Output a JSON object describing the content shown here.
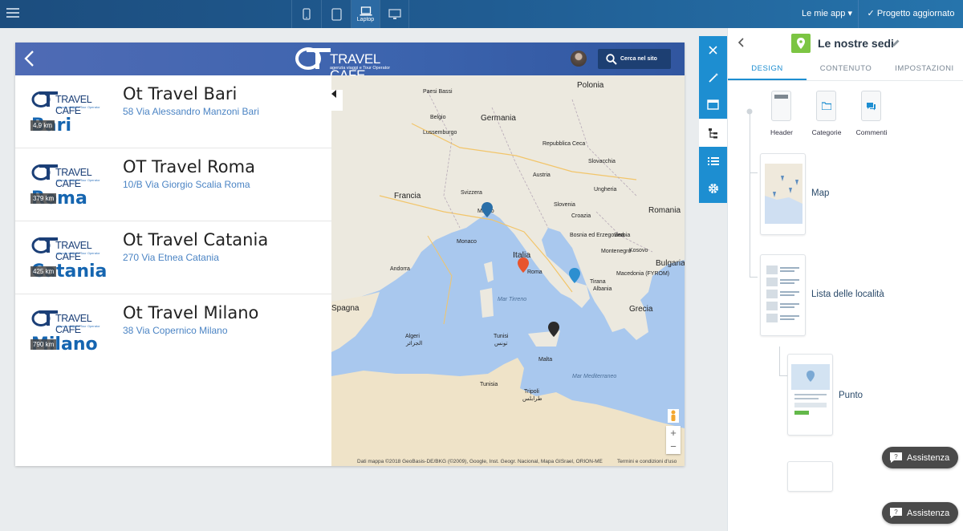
{
  "topbar": {
    "laptop_label": "Laptop",
    "my_apps_label": "Le mie app",
    "publish_label": "Progetto aggiornato"
  },
  "app": {
    "logo_text": "TRAVEL CAFE",
    "logo_subtitle": "agenzia viaggi e Tour Operator",
    "search_label": "Cerca nel sito",
    "locations": [
      {
        "name": "Ot Travel Bari",
        "address": "58 Via Alessandro Manzoni Bari",
        "city": "Bari",
        "distance": "4.9 km"
      },
      {
        "name": "OT Travel Roma",
        "address": "10/B Via Giorgio Scalia Roma",
        "city": "Roma",
        "distance": "379 km"
      },
      {
        "name": "Ot Travel Catania",
        "address": "270 Via Etnea Catania",
        "city": "Catania",
        "distance": "425 km"
      },
      {
        "name": "Ot Travel Milano",
        "address": "38 Via Copernico Milano",
        "city": "Milano",
        "distance": "790 km"
      }
    ],
    "card_logo_text": "TRAVEL CAFE",
    "card_logo_subtitle": "agenzia viaggi e Tour Operator"
  },
  "map": {
    "labels": {
      "polonia": "Polonia",
      "paesi_bassi": "Paesi Bassi",
      "belgio": "Belgio",
      "germania": "Germania",
      "lussemburgo": "Lussemburgo",
      "repubblica_ceca": "Repubblica Ceca",
      "slovacchia": "Slovacchia",
      "francia": "Francia",
      "austria": "Austria",
      "ungheria": "Ungheria",
      "svizzera": "Svizzera",
      "milano": "Milano",
      "slovenia": "Slovenia",
      "croazia": "Croazia",
      "romania": "Romania",
      "bosnia": "Bosnia ed Erzegovina",
      "serbia": "Serbia",
      "monaco": "Monaco",
      "montenegro": "Montenegro",
      "kosovo": "Kosovo",
      "bulgaria": "Bulgaria",
      "andorra": "Andorra",
      "italia": "Italia",
      "roma": "Roma",
      "macedonia": "Macedonia (FYROM)",
      "tirana": "Tirana",
      "albania": "Albania",
      "spagna": "Spagna",
      "mar_tirreno": "Mar Tirreno",
      "grecia": "Grecia",
      "algeri": "Algeri",
      "tunisi": "Tunisi",
      "algeri_ar": "الجزائر",
      "tunisi_ar": "تونس",
      "malta": "Malta",
      "tunisia": "Tunisia",
      "mar_mediterraneo": "Mar Mediterraneo",
      "tripoli": "Tripoli",
      "tripoli_ar": "طرابلس"
    },
    "attribution": "Dati mappa ©2018 GeoBasis-DE/BKG (©2009), Google, Inst. Geogr. Nacional, Mapa GISrael, ORION-ME",
    "terms": "Termini e condizioni d'uso",
    "zoom_in": "+",
    "zoom_out": "−",
    "pin_colors": {
      "milano": "#2a6fa8",
      "roma": "#e8552e",
      "bari": "#2c8fd0",
      "catania": "#2b2b2b"
    }
  },
  "panel": {
    "title": "Le nostre sedi",
    "tabs": [
      "DESIGN",
      "CONTENUTO",
      "IMPOSTAZIONI"
    ],
    "mini_blocks": [
      "Header",
      "Categorie",
      "Commenti"
    ],
    "nodes": {
      "map": "Map",
      "list": "Lista delle località",
      "point": "Punto"
    }
  },
  "assistance_label": "Assistenza",
  "colors": {
    "accent": "#1d8ed1",
    "header": "#3b63ad",
    "green": "#7cc543"
  }
}
